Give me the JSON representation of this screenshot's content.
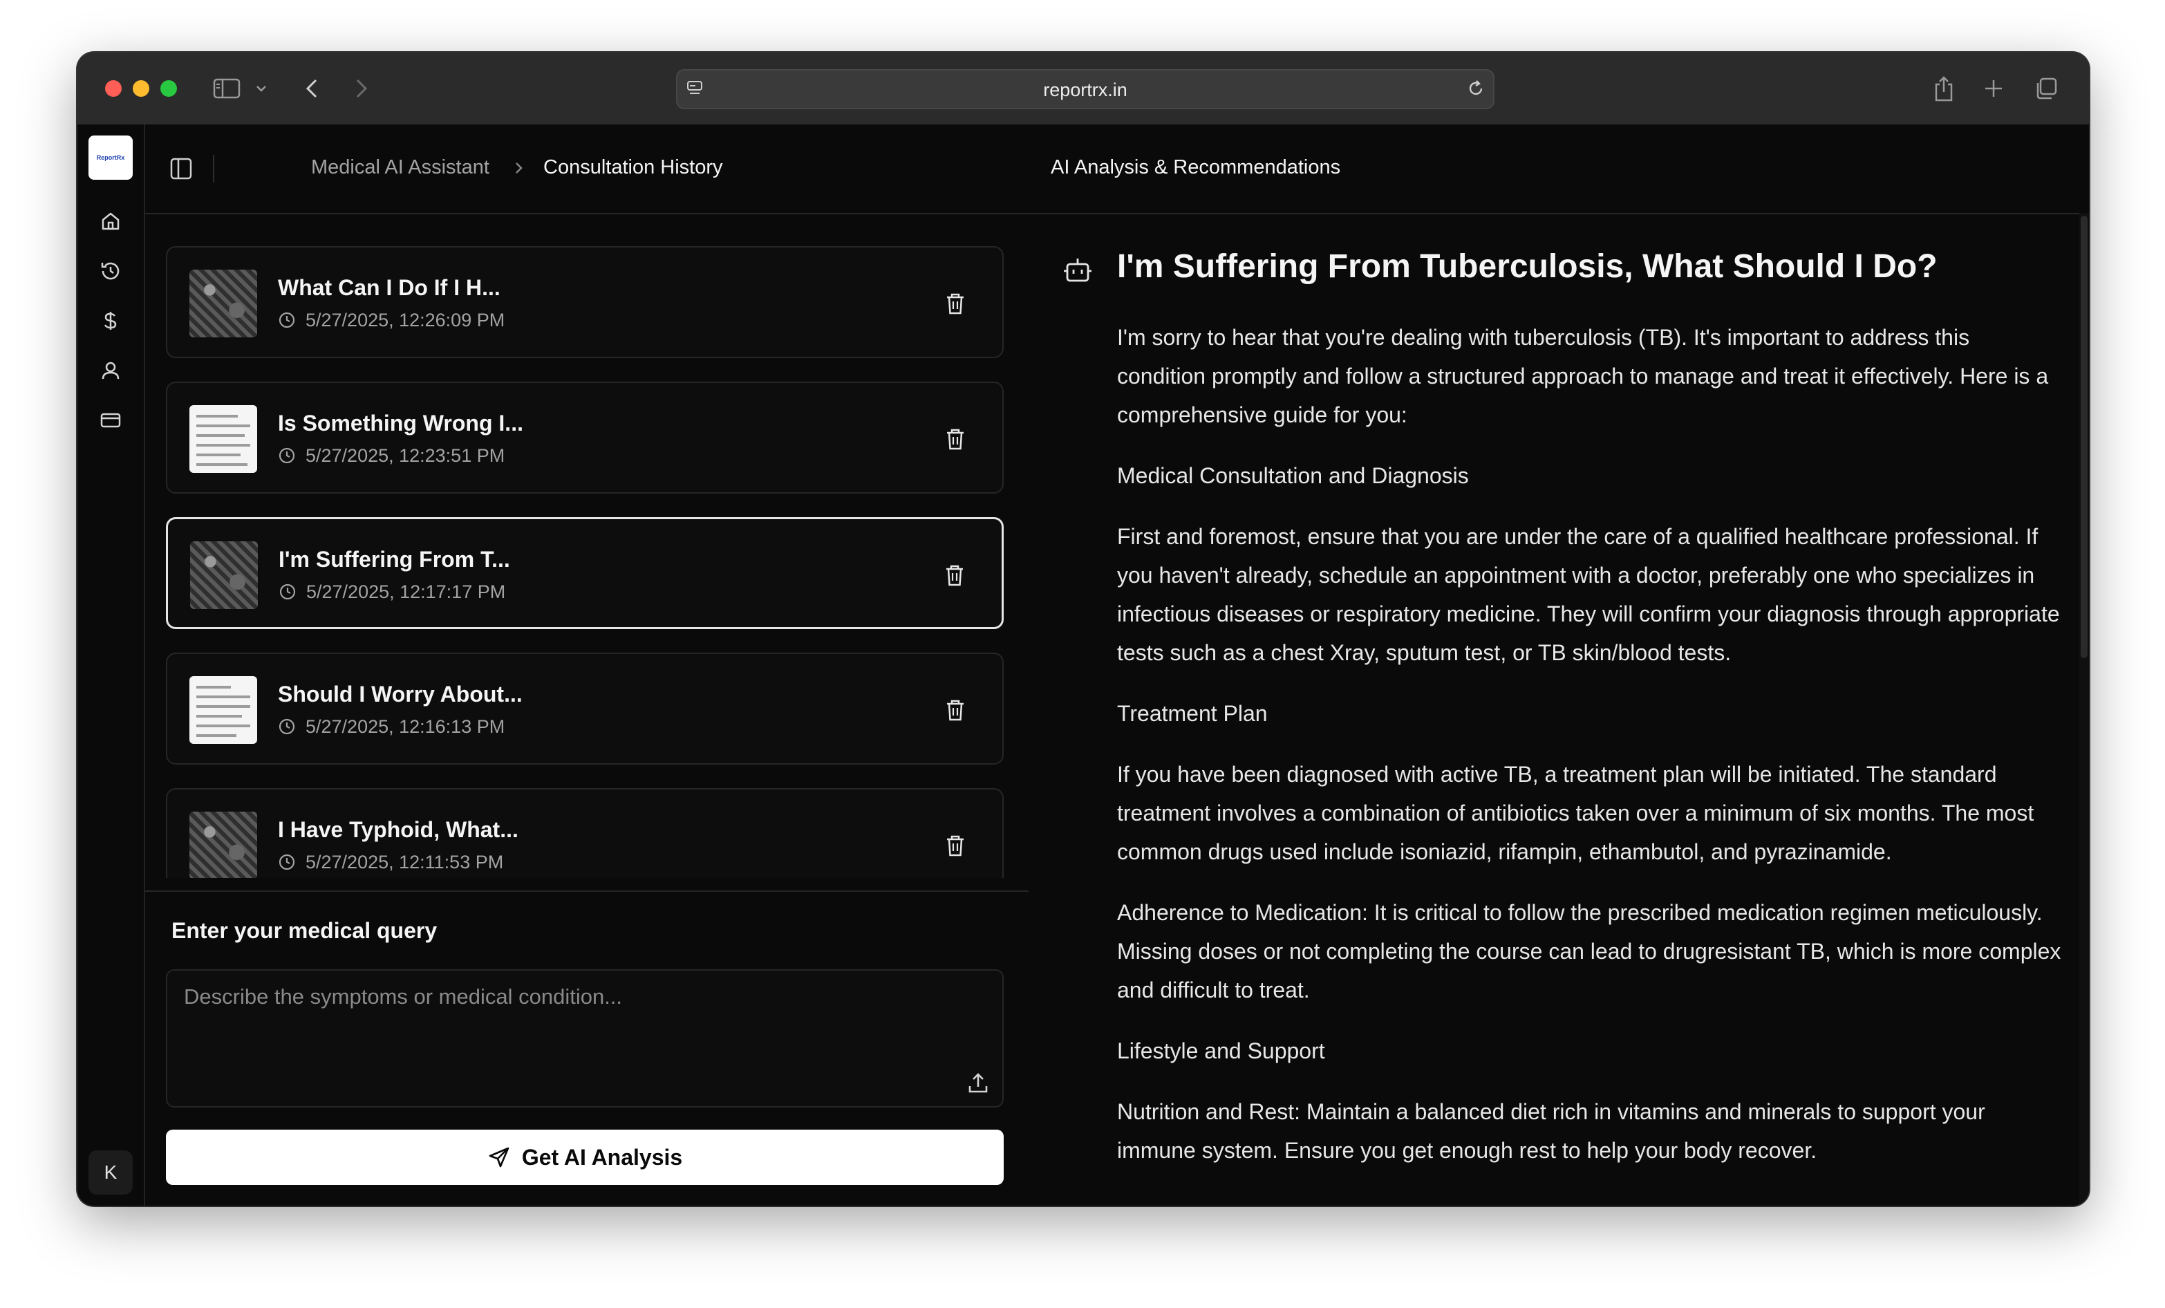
{
  "browser": {
    "url": "reportrx.in"
  },
  "rail": {
    "logo_text": "ReportRx",
    "avatar_initial": "K"
  },
  "header": {
    "breadcrumb_parent": "Medical AI Assistant",
    "breadcrumb_current": "Consultation History"
  },
  "consultations": [
    {
      "title": "What Can I Do If I H...",
      "timestamp": "5/27/2025, 12:26:09 PM",
      "thumbnail": "xray",
      "active": false
    },
    {
      "title": "Is Something Wrong I...",
      "timestamp": "5/27/2025, 12:23:51 PM",
      "thumbnail": "document",
      "active": false
    },
    {
      "title": "I'm Suffering From T...",
      "timestamp": "5/27/2025, 12:17:17 PM",
      "thumbnail": "xray",
      "active": true
    },
    {
      "title": "Should I Worry About...",
      "timestamp": "5/27/2025, 12:16:13 PM",
      "thumbnail": "document",
      "active": false
    },
    {
      "title": "I Have Typhoid, What...",
      "timestamp": "5/27/2025, 12:11:53 PM",
      "thumbnail": "xray",
      "active": false
    }
  ],
  "query": {
    "label": "Enter your medical query",
    "placeholder": "Describe the symptoms or medical condition...",
    "value": "",
    "submit_label": "Get AI Analysis"
  },
  "analysis": {
    "panel_title": "AI Analysis & Recommendations",
    "question": "I'm Suffering From Tuberculosis, What Should I Do?",
    "paragraphs": [
      "I'm sorry to hear that you're dealing with tuberculosis (TB). It's important to address this condition promptly and follow a structured approach to manage and treat it effectively. Here is a comprehensive guide for you:",
      "Medical Consultation and Diagnosis",
      "First and foremost, ensure that you are under the care of a qualified healthcare professional. If you haven't already, schedule an appointment with a doctor, preferably one who specializes in infectious diseases or respiratory medicine. They will confirm your diagnosis through appropriate tests such as a chest Xray, sputum test, or TB skin/blood tests.",
      "Treatment Plan",
      "If you have been diagnosed with active TB, a treatment plan will be initiated. The standard treatment involves a combination of antibiotics taken over a minimum of six months. The most common drugs used include isoniazid, rifampin, ethambutol, and pyrazinamide.",
      "Adherence to Medication: It is critical to follow the prescribed medication regimen meticulously. Missing doses or not completing the course can lead to drugresistant TB, which is more complex and difficult to treat.",
      "Lifestyle and Support",
      "Nutrition and Rest: Maintain a balanced diet rich in vitamins and minerals to support your immune system. Ensure you get enough rest to help your body recover."
    ]
  }
}
